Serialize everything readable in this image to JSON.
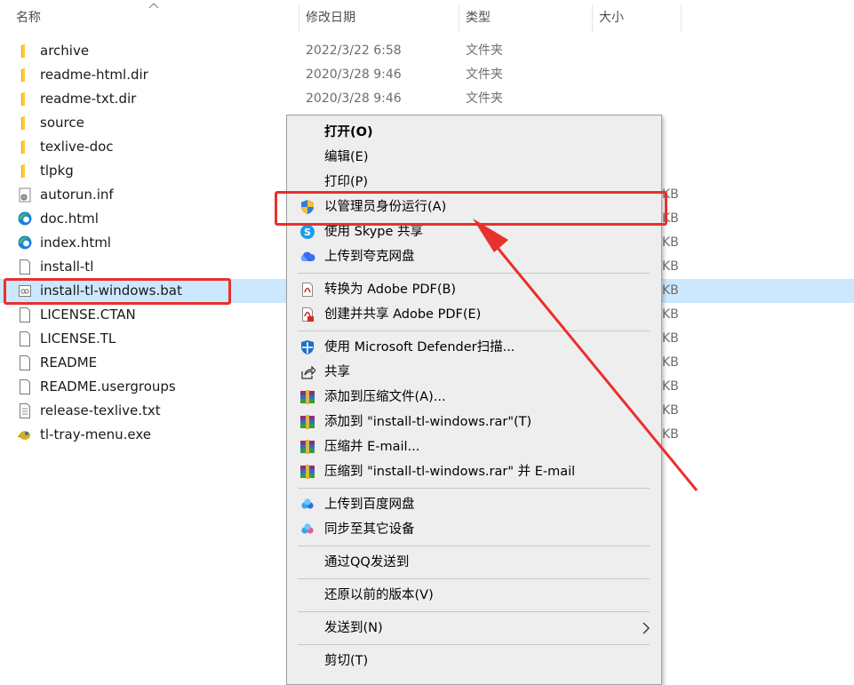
{
  "header": {
    "name": "名称",
    "date": "修改日期",
    "type": "类型",
    "size": "大小"
  },
  "files": [
    {
      "name": "archive",
      "date": "2022/3/22 6:58",
      "type": "文件夹",
      "size": "",
      "icon": "folder-icon"
    },
    {
      "name": "readme-html.dir",
      "date": "2020/3/28 9:46",
      "type": "文件夹",
      "size": "",
      "icon": "folder-icon"
    },
    {
      "name": "readme-txt.dir",
      "date": "2020/3/28 9:46",
      "type": "文件夹",
      "size": "",
      "icon": "folder-icon"
    },
    {
      "name": "source",
      "date": "",
      "type": "",
      "size": "",
      "icon": "folder-icon"
    },
    {
      "name": "texlive-doc",
      "date": "",
      "type": "",
      "size": "",
      "icon": "folder-icon"
    },
    {
      "name": "tlpkg",
      "date": "",
      "type": "",
      "size": "",
      "icon": "folder-icon"
    },
    {
      "name": "autorun.inf",
      "date": "",
      "type": "",
      "size": "KB",
      "icon": "settings-file-icon"
    },
    {
      "name": "doc.html",
      "date": "",
      "type": "",
      "size": "KB",
      "icon": "edge-icon"
    },
    {
      "name": "index.html",
      "date": "",
      "type": "",
      "size": "KB",
      "icon": "edge-icon"
    },
    {
      "name": "install-tl",
      "date": "",
      "type": "",
      "size": "KB",
      "icon": "blank-file-icon"
    },
    {
      "name": "install-tl-windows.bat",
      "date": "",
      "type": "",
      "size": "KB",
      "icon": "batch-file-icon"
    },
    {
      "name": "LICENSE.CTAN",
      "date": "",
      "type": "",
      "size": "KB",
      "icon": "blank-file-icon"
    },
    {
      "name": "LICENSE.TL",
      "date": "",
      "type": "",
      "size": "KB",
      "icon": "blank-file-icon"
    },
    {
      "name": "README",
      "date": "",
      "type": "",
      "size": "KB",
      "icon": "blank-file-icon"
    },
    {
      "name": "README.usergroups",
      "date": "",
      "type": "",
      "size": "KB",
      "icon": "blank-file-icon"
    },
    {
      "name": "release-texlive.txt",
      "date": "",
      "type": "",
      "size": "KB",
      "icon": "text-file-icon"
    },
    {
      "name": "tl-tray-menu.exe",
      "date": "",
      "type": "",
      "size": "KB",
      "icon": "exe-icon"
    }
  ],
  "menu": [
    {
      "label": "打开(O)",
      "icon": "",
      "bold": true
    },
    {
      "label": "编辑(E)",
      "icon": ""
    },
    {
      "label": "打印(P)",
      "icon": ""
    },
    {
      "label": "以管理员身份运行(A)",
      "icon": "uac-shield-icon"
    },
    {
      "label": "使用 Skype 共享",
      "icon": "skype-icon"
    },
    {
      "label": "上传到夸克网盘",
      "icon": "quark-cloud-icon"
    },
    {
      "sep": true
    },
    {
      "label": "转换为 Adobe PDF(B)",
      "icon": "adobe-pdf-icon"
    },
    {
      "label": "创建并共享 Adobe PDF(E)",
      "icon": "adobe-pdf-share-icon"
    },
    {
      "sep": true
    },
    {
      "label": "使用 Microsoft Defender扫描...",
      "icon": "defender-icon"
    },
    {
      "label": "共享",
      "icon": "share-icon"
    },
    {
      "label": "添加到压缩文件(A)...",
      "icon": "winrar-icon"
    },
    {
      "label": "添加到 \"install-tl-windows.rar\"(T)",
      "icon": "winrar-icon"
    },
    {
      "label": "压缩并 E-mail...",
      "icon": "winrar-icon"
    },
    {
      "label": "压缩到 \"install-tl-windows.rar\" 并 E-mail",
      "icon": "winrar-icon"
    },
    {
      "sep": true
    },
    {
      "label": "上传到百度网盘",
      "icon": "baidu-cloud-icon"
    },
    {
      "label": "同步至其它设备",
      "icon": "baidu-sync-icon"
    },
    {
      "sep": true
    },
    {
      "label": "通过QQ发送到",
      "icon": ""
    },
    {
      "sep": true
    },
    {
      "label": "还原以前的版本(V)",
      "icon": ""
    },
    {
      "sep": true
    },
    {
      "label": "发送到(N)",
      "icon": "",
      "submenu": true
    },
    {
      "sep": true
    },
    {
      "label": "剪切(T)",
      "icon": ""
    }
  ],
  "colors": {
    "selection": "#cce8ff",
    "highlight": "#e8302c",
    "menu_bg": "#eeeeee"
  }
}
